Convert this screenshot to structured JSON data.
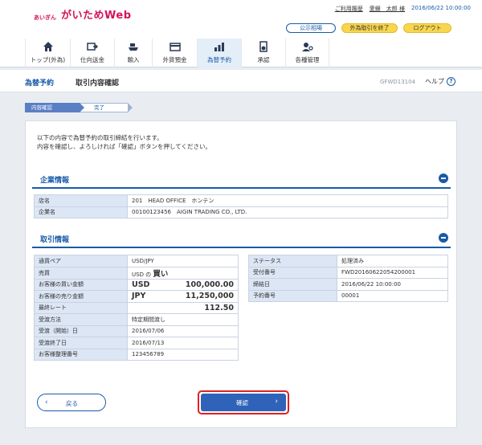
{
  "brand": {
    "sub": "あいぎん",
    "main": "がいためWeb"
  },
  "topline": {
    "history": "ご利用履歴",
    "user": "愛銀　太郎 様",
    "timestamp": "2016/06/22 10:00:00"
  },
  "header_buttons": {
    "notice": "公示相場",
    "end_fx": "外為取引を終了",
    "logout": "ログアウト"
  },
  "nav": [
    {
      "label": "トップ(外為)",
      "icon": "home-icon"
    },
    {
      "label": "仕向送金",
      "icon": "transfer-icon"
    },
    {
      "label": "輸入",
      "icon": "ship-icon"
    },
    {
      "label": "外貨預金",
      "icon": "deposit-icon"
    },
    {
      "label": "為替予約",
      "icon": "chart-icon",
      "active": true
    },
    {
      "label": "承認",
      "icon": "approve-icon"
    },
    {
      "label": "各種管理",
      "icon": "manage-icon"
    }
  ],
  "page": {
    "section": "為替予約",
    "title": "取引内容確認",
    "screen_code": "GFWD13104",
    "help": "ヘルプ"
  },
  "steps": [
    "内容確認",
    "完了"
  ],
  "intro": {
    "line1": "以下の内容で為替予約の取引締結を行います。",
    "line2": "内容を確認し、よろしければ「確認」ボタンを押してください。"
  },
  "company": {
    "title": "企業情報",
    "rows": [
      {
        "k": "店名",
        "v": "201　HEAD OFFICE　ホンテン"
      },
      {
        "k": "企業名",
        "v": "00100123456　AIGIN TRADING CO., LTD."
      }
    ]
  },
  "trade": {
    "title": "取引情報",
    "left": {
      "pair_k": "通貨ペア",
      "pair_v": "USD/JPY",
      "side_k": "売買",
      "side_pre": "USD の",
      "side_v": "買い",
      "buy_k": "お客様の買い金額",
      "buy_ccy": "USD",
      "buy_amt": "100,000.00",
      "sell_k": "お客様の売り金額",
      "sell_ccy": "JPY",
      "sell_amt": "11,250,000",
      "rate_k": "最終レート",
      "rate_v": "112.50",
      "method_k": "受渡方法",
      "method_v": "特定期間渡し",
      "start_k": "受渡（開始）日",
      "start_v": "2016/07/06",
      "end_k": "受渡終了日",
      "end_v": "2016/07/13",
      "ref_k": "お客様整理番号",
      "ref_v": "123456789"
    },
    "right": {
      "status_k": "ステータス",
      "status_v": "処理済み",
      "recv_k": "受付番号",
      "recv_v": "FWD20160622054200001",
      "date_k": "締結日",
      "date_v": "2016/06/22 10:00:00",
      "num_k": "予約番号",
      "num_v": "00001"
    }
  },
  "buttons": {
    "back": "戻る",
    "confirm": "確認"
  },
  "colors": {
    "accent": "#1a5aa8",
    "brand": "#d4145a",
    "highlight": "#e02020"
  }
}
